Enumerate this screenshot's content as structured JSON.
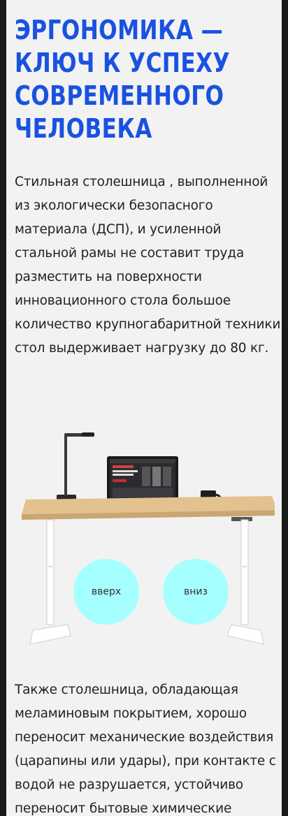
{
  "headline": {
    "lines": [
      "ЭРГОНОМИКА —",
      "КЛЮЧ К УСПЕХУ",
      "СОВРЕМЕННОГО",
      "ЧЕЛОВЕКА"
    ]
  },
  "paragraph1": {
    "lines": [
      "Стильная столешница , выполненной",
      "из экологически безопасного",
      "материала (ДСП), и усиленной",
      "стальной рамы не составит труда",
      "разместить на поверхности",
      "инновационного стола большое",
      "количество крупногабаритной техники:",
      "стол выдерживает нагрузку до 80 кг."
    ]
  },
  "controls": {
    "up_label": "вверх",
    "down_label": "вниз"
  },
  "paragraph2": {
    "lines": [
      "Также столешница, обладающая",
      "меламиновым покрытием, хорошо",
      "переносит механические воздействия",
      "(царапины или удары), при контакте с",
      "водой не разрушается, устойчиво",
      "переносит бытовые химические"
    ]
  },
  "colors": {
    "headline": "#1a52e0",
    "button": "#a6ffff",
    "background": "#f2f2f2",
    "text": "#222222"
  }
}
